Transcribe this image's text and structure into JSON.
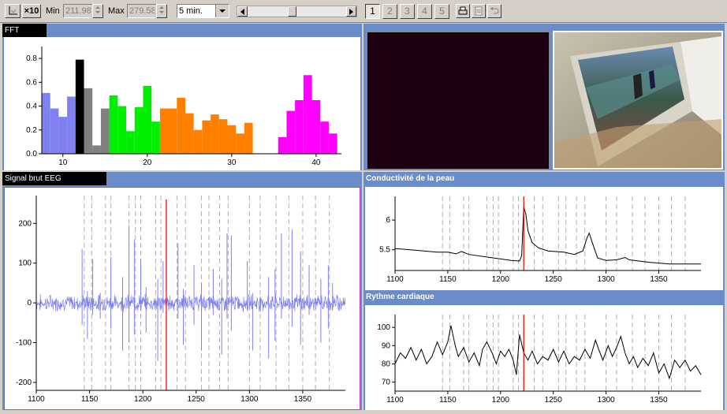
{
  "toolbar": {
    "zoom_reset_icon": "axis-icon",
    "zoom_label": "×10",
    "min_label": "Min",
    "min_value": "211.98",
    "max_label": "Max",
    "max_value": "279.58",
    "window_select": "5 min.",
    "scroll_position": 0.45,
    "pages": [
      "1",
      "2",
      "3",
      "4",
      "5"
    ],
    "active_page": "1",
    "icons": [
      "print-icon",
      "delete-icon",
      "undo-icon"
    ]
  },
  "panels": {
    "fft_title": "FFT",
    "eeg_title": "Signal brut EEG",
    "skin_title": "Conductivité de la peau",
    "heart_title": "Rythme cardiaque"
  },
  "colors": {
    "panel_bg": "#6a8cc8",
    "cursor": "#e00000",
    "eeg_line": "#8080f0",
    "fft_blue": "#8080f0",
    "fft_black": "#000000",
    "fft_gray": "#808080",
    "fft_green": "#00ee00",
    "fft_orange": "#ff8000",
    "fft_magenta": "#ff00ff",
    "video_bg": "#1a0010"
  },
  "chart_data": [
    {
      "type": "bar",
      "name": "fft",
      "xticks": [
        10,
        20,
        30,
        40
      ],
      "yticks": [
        "0.0",
        "0.2",
        "0.4",
        "0.6",
        "0.8"
      ],
      "ylim": [
        0,
        0.9
      ],
      "xlim": [
        7.5,
        43
      ],
      "series": [
        {
          "color": "#8080f0",
          "x": [
            8,
            9,
            10,
            11
          ],
          "values": [
            0.51,
            0.38,
            0.31,
            0.48
          ]
        },
        {
          "color": "#000000",
          "x": [
            12
          ],
          "values": [
            0.79
          ]
        },
        {
          "color": "#808080",
          "x": [
            13,
            14,
            15
          ],
          "values": [
            0.55,
            0.07,
            0.38
          ]
        },
        {
          "color": "#00ee00",
          "x": [
            16,
            17,
            18,
            19,
            20,
            21
          ],
          "values": [
            0.49,
            0.4,
            0.19,
            0.39,
            0.57,
            0.27
          ]
        },
        {
          "color": "#ff8000",
          "x": [
            22,
            23,
            24,
            25,
            26,
            27,
            28,
            29,
            30,
            31,
            32
          ],
          "values": [
            0.38,
            0.38,
            0.47,
            0.34,
            0.2,
            0.28,
            0.33,
            0.29,
            0.24,
            0.17,
            0.26
          ]
        },
        {
          "color": "#ff00ff",
          "x": [
            36,
            37,
            38,
            39,
            40,
            41,
            42
          ],
          "values": [
            0.14,
            0.36,
            0.45,
            0.66,
            0.45,
            0.27,
            0.17
          ]
        }
      ]
    },
    {
      "type": "line",
      "name": "eeg",
      "xlim": [
        1100,
        1390
      ],
      "ylim": [
        -220,
        270
      ],
      "xticks": [
        1100,
        1150,
        1200,
        1250,
        1300,
        1350
      ],
      "yticks": [
        -200,
        -100,
        0,
        100,
        200
      ],
      "cursor_x": 1222,
      "event_lines": [
        1145,
        1152,
        1165,
        1170,
        1187,
        1193,
        1198,
        1212,
        1217,
        1232,
        1240,
        1255,
        1262,
        1272,
        1280,
        1300,
        1310,
        1325,
        1337,
        1350,
        1362,
        1375
      ],
      "spikes": [
        {
          "x": 1143,
          "up": 135,
          "down": -55
        },
        {
          "x": 1148,
          "up": 30,
          "down": -90
        },
        {
          "x": 1153,
          "up": 110,
          "down": -30
        },
        {
          "x": 1160,
          "up": 25,
          "down": -40
        },
        {
          "x": 1170,
          "up": 115,
          "down": -65
        },
        {
          "x": 1181,
          "up": 65,
          "down": -120
        },
        {
          "x": 1187,
          "up": 195,
          "down": -100
        },
        {
          "x": 1192,
          "up": 160,
          "down": -80
        },
        {
          "x": 1198,
          "up": 110,
          "down": -20
        },
        {
          "x": 1203,
          "up": 40,
          "down": -75
        },
        {
          "x": 1214,
          "up": 60,
          "down": -145
        },
        {
          "x": 1219,
          "up": 105,
          "down": -25
        },
        {
          "x": 1233,
          "up": 150,
          "down": -40
        },
        {
          "x": 1238,
          "up": 35,
          "down": -105
        },
        {
          "x": 1248,
          "up": 95,
          "down": -55
        },
        {
          "x": 1255,
          "up": 50,
          "down": -120
        },
        {
          "x": 1266,
          "up": 85,
          "down": -30
        },
        {
          "x": 1274,
          "up": 60,
          "down": -130
        },
        {
          "x": 1279,
          "up": 175,
          "down": -40
        },
        {
          "x": 1283,
          "up": 170,
          "down": -70
        },
        {
          "x": 1298,
          "up": 105,
          "down": -20
        },
        {
          "x": 1303,
          "up": 25,
          "down": -120
        },
        {
          "x": 1318,
          "up": 65,
          "down": -140
        },
        {
          "x": 1324,
          "up": 85,
          "down": -95
        },
        {
          "x": 1330,
          "up": 175,
          "down": -40
        },
        {
          "x": 1340,
          "up": 185,
          "down": -60
        },
        {
          "x": 1348,
          "up": 130,
          "down": -105
        },
        {
          "x": 1356,
          "up": 95,
          "down": -30
        },
        {
          "x": 1367,
          "up": 60,
          "down": -100
        },
        {
          "x": 1374,
          "up": 95,
          "down": -65
        },
        {
          "x": 1378,
          "up": 50,
          "down": -20
        }
      ]
    },
    {
      "type": "line",
      "name": "skin_conductance",
      "xlim": [
        1100,
        1390
      ],
      "ylim": [
        5.15,
        6.4
      ],
      "xticks": [
        1100,
        1150,
        1200,
        1250,
        1300,
        1350
      ],
      "yticks": [
        5.5,
        6.0
      ],
      "cursor_x": 1222,
      "event_lines": [
        1145,
        1152,
        1165,
        1170,
        1187,
        1193,
        1198,
        1212,
        1217,
        1232,
        1240,
        1255,
        1262,
        1272,
        1280,
        1300,
        1310,
        1325,
        1337,
        1350,
        1362,
        1375
      ],
      "points": [
        [
          1100,
          5.52
        ],
        [
          1120,
          5.49
        ],
        [
          1140,
          5.46
        ],
        [
          1150,
          5.46
        ],
        [
          1158,
          5.43
        ],
        [
          1163,
          5.47
        ],
        [
          1170,
          5.42
        ],
        [
          1190,
          5.37
        ],
        [
          1210,
          5.32
        ],
        [
          1218,
          5.31
        ],
        [
          1220,
          5.4
        ],
        [
          1222,
          6.22
        ],
        [
          1224,
          6.1
        ],
        [
          1226,
          5.82
        ],
        [
          1230,
          5.62
        ],
        [
          1236,
          5.53
        ],
        [
          1245,
          5.48
        ],
        [
          1260,
          5.46
        ],
        [
          1270,
          5.42
        ],
        [
          1278,
          5.48
        ],
        [
          1282,
          5.7
        ],
        [
          1284,
          5.78
        ],
        [
          1287,
          5.62
        ],
        [
          1292,
          5.36
        ],
        [
          1300,
          5.32
        ],
        [
          1310,
          5.33
        ],
        [
          1318,
          5.37
        ],
        [
          1322,
          5.33
        ],
        [
          1340,
          5.29
        ],
        [
          1360,
          5.26
        ],
        [
          1375,
          5.26
        ],
        [
          1390,
          5.26
        ]
      ]
    },
    {
      "type": "line",
      "name": "heart_rate",
      "xlim": [
        1100,
        1390
      ],
      "ylim": [
        65,
        107
      ],
      "xticks": [
        1100,
        1150,
        1200,
        1250,
        1300,
        1350
      ],
      "yticks": [
        70,
        80,
        90,
        100
      ],
      "cursor_x": 1222,
      "event_lines": [
        1145,
        1152,
        1165,
        1170,
        1187,
        1193,
        1198,
        1212,
        1217,
        1232,
        1240,
        1255,
        1262,
        1272,
        1280,
        1300,
        1310,
        1325,
        1337,
        1350,
        1362,
        1375
      ],
      "points": [
        [
          1100,
          80
        ],
        [
          1105,
          86
        ],
        [
          1110,
          83
        ],
        [
          1115,
          89
        ],
        [
          1120,
          82
        ],
        [
          1125,
          88
        ],
        [
          1130,
          80
        ],
        [
          1135,
          84
        ],
        [
          1140,
          92
        ],
        [
          1145,
          85
        ],
        [
          1150,
          92
        ],
        [
          1153,
          101
        ],
        [
          1157,
          90
        ],
        [
          1160,
          84
        ],
        [
          1165,
          89
        ],
        [
          1170,
          81
        ],
        [
          1175,
          86
        ],
        [
          1180,
          79
        ],
        [
          1183,
          88
        ],
        [
          1187,
          92
        ],
        [
          1192,
          86
        ],
        [
          1196,
          80
        ],
        [
          1200,
          87
        ],
        [
          1204,
          84
        ],
        [
          1208,
          88
        ],
        [
          1212,
          82
        ],
        [
          1215,
          74
        ],
        [
          1218,
          96
        ],
        [
          1222,
          86
        ],
        [
          1226,
          82
        ],
        [
          1230,
          87
        ],
        [
          1235,
          80
        ],
        [
          1240,
          84
        ],
        [
          1245,
          82
        ],
        [
          1250,
          88
        ],
        [
          1255,
          81
        ],
        [
          1260,
          87
        ],
        [
          1265,
          80
        ],
        [
          1270,
          84
        ],
        [
          1275,
          82
        ],
        [
          1280,
          88
        ],
        [
          1285,
          83
        ],
        [
          1290,
          93
        ],
        [
          1293,
          88
        ],
        [
          1297,
          82
        ],
        [
          1302,
          90
        ],
        [
          1306,
          84
        ],
        [
          1310,
          89
        ],
        [
          1314,
          95
        ],
        [
          1318,
          86
        ],
        [
          1322,
          80
        ],
        [
          1326,
          84
        ],
        [
          1330,
          78
        ],
        [
          1335,
          83
        ],
        [
          1340,
          79
        ],
        [
          1345,
          86
        ],
        [
          1350,
          75
        ],
        [
          1355,
          80
        ],
        [
          1360,
          72
        ],
        [
          1365,
          82
        ],
        [
          1370,
          78
        ],
        [
          1375,
          82
        ],
        [
          1380,
          76
        ],
        [
          1385,
          79
        ],
        [
          1390,
          74
        ]
      ]
    }
  ]
}
